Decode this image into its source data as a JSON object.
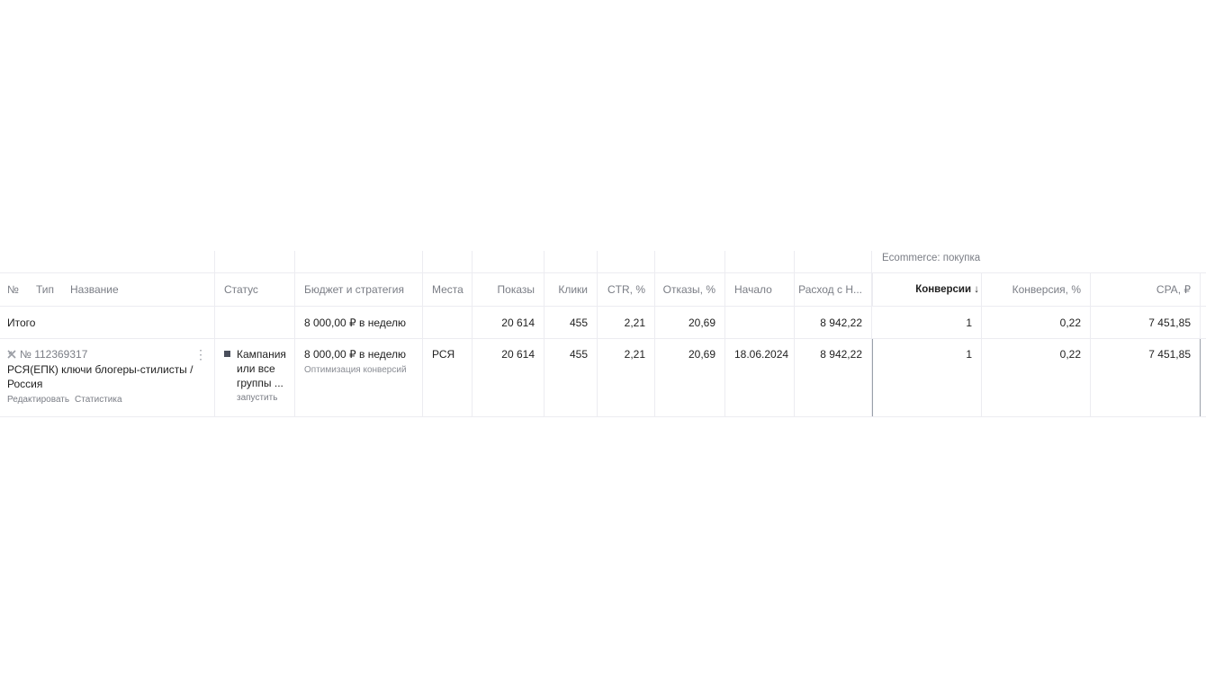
{
  "group_header": "Ecommerce: покупка",
  "columns": {
    "num": "№",
    "type": "Тип",
    "name": "Название",
    "status": "Статус",
    "budget": "Бюджет и стратегия",
    "places": "Места",
    "impressions": "Показы",
    "clicks": "Клики",
    "ctr": "CTR, %",
    "bounces": "Отказы, %",
    "start": "Начало",
    "spend": "Расход с Н...",
    "conversions": "Конверсии ↓",
    "conversion_rate": "Конверсия, %",
    "cpa": "CPA, ₽"
  },
  "totals": {
    "label": "Итого",
    "budget": "8 000,00 ₽ в неделю",
    "impressions": "20 614",
    "clicks": "455",
    "ctr": "2,21",
    "bounces": "20,69",
    "spend": "8 942,22",
    "conversions": "1",
    "conversion_rate": "0,22",
    "cpa": "7 451,85"
  },
  "campaign": {
    "id": "№ 112369317",
    "name_line1": "РСЯ(ЕПК) ключи блогеры-стилисты /",
    "name_line2": "Россия",
    "edit_link": "Редактировать",
    "stats_link": "Статистика",
    "status_line1": "Кампания",
    "status_line2": "или все",
    "status_line3": "группы ...",
    "status_action": "запустить",
    "budget": "8 000,00 ₽ в неделю",
    "strategy": "Оптимизация конверсий",
    "places": "РСЯ",
    "impressions": "20 614",
    "clicks": "455",
    "ctr": "2,21",
    "bounces": "20,69",
    "start": "18.06.2024",
    "spend": "8 942,22",
    "conversions": "1",
    "conversion_rate": "0,22",
    "cpa": "7 451,85"
  }
}
